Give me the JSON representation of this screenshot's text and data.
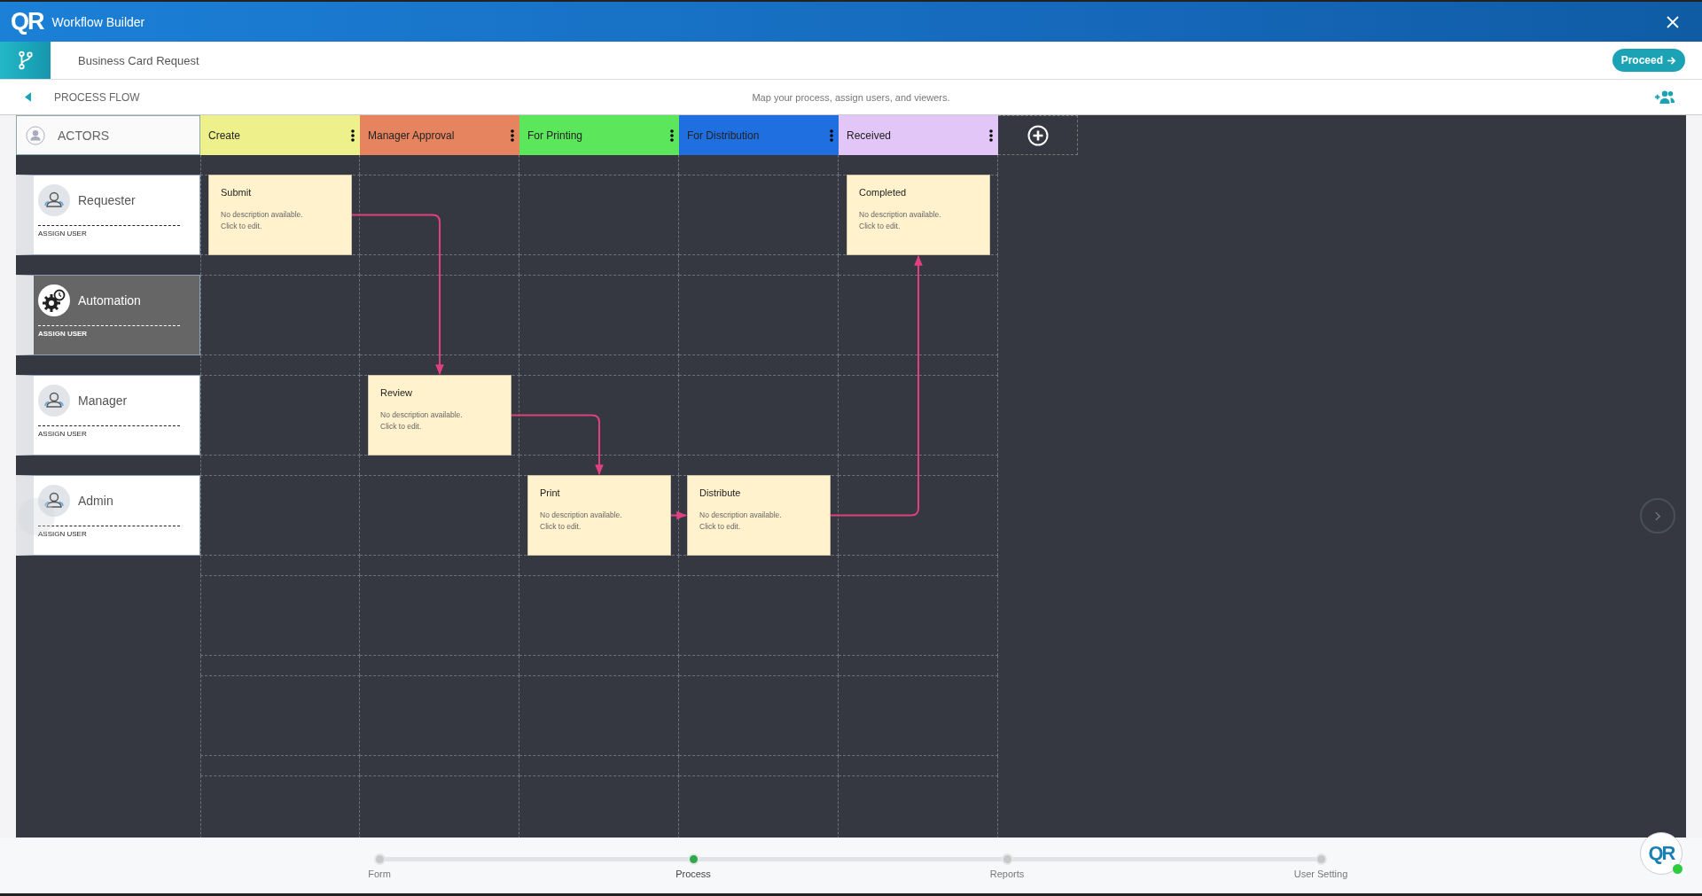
{
  "window": {
    "logo": "QR",
    "title": "Workflow Builder"
  },
  "header": {
    "title": "Business Card Request",
    "proceed_button": "Proceed"
  },
  "subheader": {
    "section": "PROCESS FLOW",
    "hint": "Map your process, assign users, and viewers."
  },
  "actors_header": "ACTORS",
  "stages": [
    {
      "name": "Create",
      "color": "#eef08c"
    },
    {
      "name": "Manager Approval",
      "color": "#e5845e"
    },
    {
      "name": "For Printing",
      "color": "#5be65b"
    },
    {
      "name": "For Distribution",
      "color": "#1f6fe0"
    },
    {
      "name": "Received",
      "color": "#e3c6f8"
    }
  ],
  "actors": [
    {
      "name": "Requester",
      "kind": "person",
      "action": "ASSIGN USER",
      "lanes": [
        {
          "kind": "step",
          "title": "Submit",
          "description": "No description available.\nClick to edit."
        },
        {
          "kind": "empty"
        },
        {
          "kind": "empty"
        },
        {
          "kind": "empty"
        },
        {
          "kind": "step",
          "title": "Completed",
          "description": "No description available.\nClick to edit."
        }
      ]
    },
    {
      "name": "Automation",
      "kind": "automation",
      "action": "ASSIGN USER",
      "lanes": [
        {
          "kind": "empty"
        },
        {
          "kind": "empty"
        },
        {
          "kind": "empty"
        },
        {
          "kind": "empty"
        },
        {
          "kind": "empty"
        }
      ]
    },
    {
      "name": "Manager",
      "kind": "person",
      "action": "ASSIGN USER",
      "lanes": [
        {
          "kind": "empty"
        },
        {
          "kind": "step",
          "title": "Review",
          "description": "No description available.\nClick to edit."
        },
        {
          "kind": "empty"
        },
        {
          "kind": "empty"
        },
        {
          "kind": "empty"
        }
      ]
    },
    {
      "name": "Admin",
      "kind": "person",
      "action": "ASSIGN USER",
      "lanes": [
        {
          "kind": "empty"
        },
        {
          "kind": "empty"
        },
        {
          "kind": "step",
          "title": "Print",
          "description": "No description available.\nClick to edit."
        },
        {
          "kind": "step",
          "title": "Distribute",
          "description": "No description available.\nClick to edit."
        },
        {
          "kind": "empty"
        }
      ]
    }
  ],
  "nav_steps": [
    {
      "label": "Form",
      "selected": false
    },
    {
      "label": "Process",
      "selected": true
    },
    {
      "label": "Reports",
      "selected": false
    },
    {
      "label": "User Setting",
      "selected": false
    }
  ],
  "corner_logo": "QR"
}
